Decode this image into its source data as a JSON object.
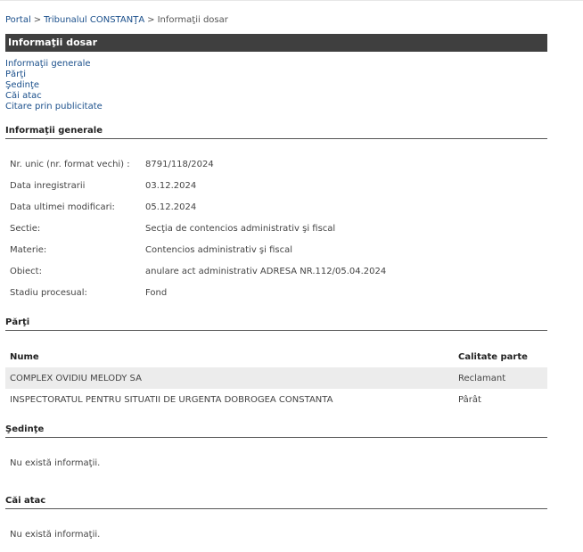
{
  "breadcrumb": {
    "portal": "Portal",
    "sep": ">",
    "court": "Tribunalul CONSTANŢA",
    "current": "Informaţii dosar"
  },
  "title": "Informaţii dosar",
  "anchors": [
    "Informaţii generale",
    "Părţi",
    "Şedinţe",
    "Căi atac",
    "Citare prin publicitate"
  ],
  "general": {
    "heading": "Informaţii generale",
    "rows": [
      {
        "label": "Nr. unic (nr. format vechi) :",
        "value": "8791/118/2024"
      },
      {
        "label": "Data inregistrarii",
        "value": "03.12.2024"
      },
      {
        "label": "Data ultimei modificari:",
        "value": "05.12.2024"
      },
      {
        "label": "Sectie:",
        "value": "Secţia de contencios administrativ şi fiscal"
      },
      {
        "label": "Materie:",
        "value": "Contencios administrativ şi fiscal"
      },
      {
        "label": "Obiect:",
        "value": "anulare act administrativ ADRESA NR.112/05.04.2024"
      },
      {
        "label": "Stadiu procesual:",
        "value": "Fond"
      }
    ]
  },
  "parti": {
    "heading": "Părţi",
    "columns": [
      "Nume",
      "Calitate parte"
    ],
    "rows": [
      {
        "name": "COMPLEX OVIDIU MELODY SA",
        "role": "Reclamant"
      },
      {
        "name": "INSPECTORATUL PENTRU SITUATII DE URGENTA DOBROGEA CONSTANTA",
        "role": "Pârât"
      }
    ]
  },
  "sedinte": {
    "heading": "Şedinţe",
    "empty": "Nu există informaţii."
  },
  "cai_atac": {
    "heading": "Căi atac",
    "empty": "Nu există informaţii."
  }
}
